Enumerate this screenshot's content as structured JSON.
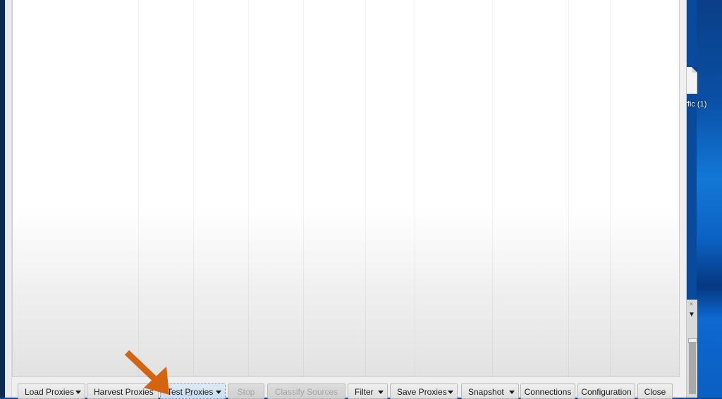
{
  "desktop": {
    "icon_label": "ffic (1)",
    "icon_name": "document-file-icon"
  },
  "toolbar": {
    "buttons": [
      {
        "id": "load-proxies",
        "label": "Load Proxies",
        "has_dropdown": true,
        "enabled": true
      },
      {
        "id": "harvest-proxies",
        "label": "Harvest Proxies",
        "has_dropdown": false,
        "enabled": true
      },
      {
        "id": "test-proxies",
        "label": "Test Proxies",
        "has_dropdown": true,
        "enabled": true,
        "focused": true
      },
      {
        "id": "stop",
        "label": "Stop",
        "has_dropdown": false,
        "enabled": false
      },
      {
        "id": "classify-sources",
        "label": "Classify Sources",
        "has_dropdown": false,
        "enabled": false
      },
      {
        "id": "filter",
        "label": "Filter",
        "has_dropdown": true,
        "enabled": true
      },
      {
        "id": "save-proxies",
        "label": "Save Proxies",
        "has_dropdown": true,
        "enabled": true
      },
      {
        "id": "snapshot",
        "label": "Snapshot",
        "has_dropdown": true,
        "enabled": true
      },
      {
        "id": "connections",
        "label": "Connections",
        "has_dropdown": false,
        "enabled": true
      },
      {
        "id": "configuration",
        "label": "Configuration",
        "has_dropdown": false,
        "enabled": true
      },
      {
        "id": "close",
        "label": "Close",
        "has_dropdown": false,
        "enabled": true
      }
    ]
  },
  "annotation": {
    "type": "arrow",
    "color": "#d4640f",
    "points_to": "test-proxies"
  },
  "colors": {
    "desktop_blue": "#0a4fa5",
    "arrow_orange": "#d4640f",
    "disabled_text": "#a5a5a5"
  }
}
